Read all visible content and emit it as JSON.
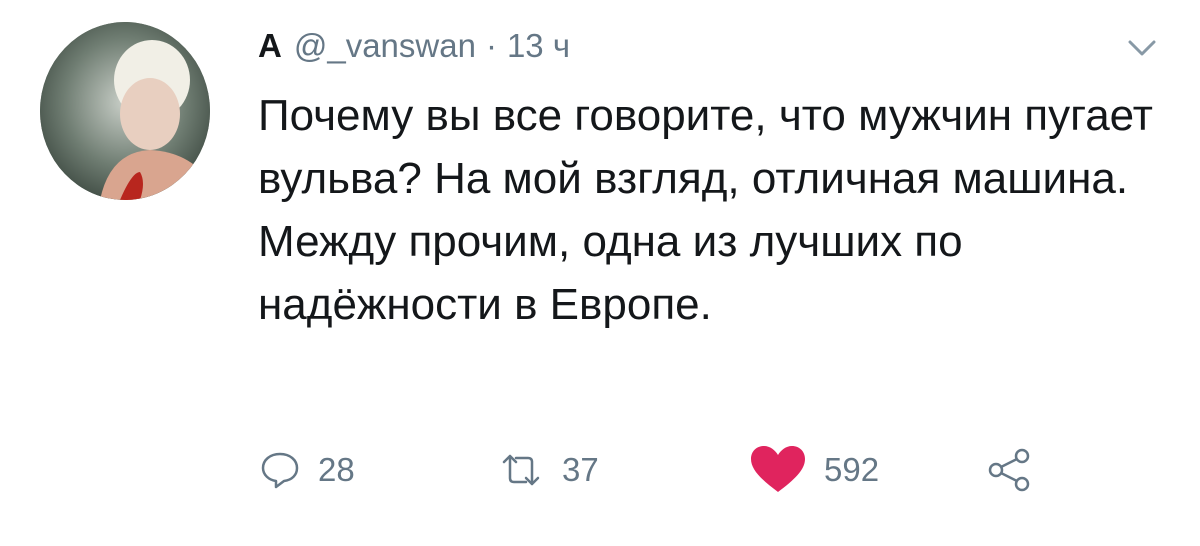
{
  "tweet": {
    "display_name": "А",
    "handle": "@_vanswan",
    "separator": "·",
    "time": "13 ч",
    "text": "Почему вы все говорите, что мужчин пугает вульва? На мой взгляд, отличная машина. Между прочим, одна из лучших по надёжности в Европе.",
    "avatar_icon": "profile-photo",
    "caret_icon": "chevron-down-icon"
  },
  "actions": {
    "reply": {
      "icon": "reply-icon",
      "count": "28"
    },
    "retweet": {
      "icon": "retweet-icon",
      "count": "37"
    },
    "like": {
      "icon": "heart-icon",
      "count": "592",
      "color": "#e0245e"
    },
    "share": {
      "icon": "share-icon"
    }
  },
  "colors": {
    "text": "#14171a",
    "secondary": "#657786",
    "like": "#e0245e"
  }
}
